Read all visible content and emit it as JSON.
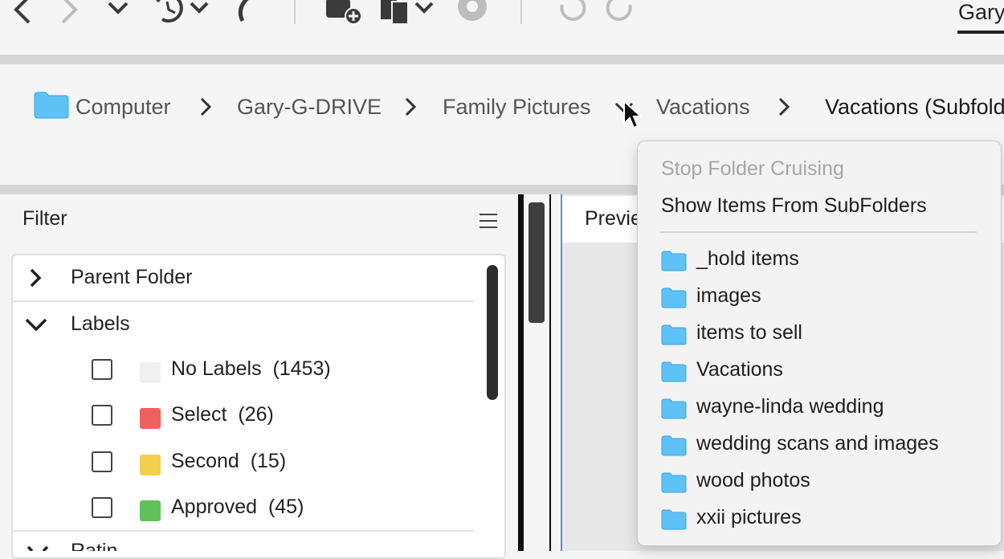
{
  "toolbar": {
    "icons": [
      "back-arrow-icon",
      "forward-arrow-icon",
      "chevron-down-icon",
      "recent-history-icon",
      "boomerang-icon",
      "get-photos-icon",
      "copy-to-icon",
      "camera-raw-icon",
      "rotate-left-icon",
      "rotate-right-icon"
    ],
    "workspace_tab": "Gary"
  },
  "breadcrumb": {
    "items": [
      "Computer",
      "Gary-G-DRIVE",
      "Family Pictures",
      "Vacations",
      "Vacations (Subfold"
    ],
    "folder_color": "#5ec2f7"
  },
  "filter": {
    "title": "Filter",
    "sections": {
      "parent_folder": "Parent Folder",
      "labels": "Labels",
      "ratings": "Ratin"
    },
    "labels": [
      {
        "name": "No Labels",
        "count": "(1453)",
        "color": "#f0f0f0"
      },
      {
        "name": "Select",
        "count": "(26)",
        "color": "#f06060"
      },
      {
        "name": "Second",
        "count": "(15)",
        "color": "#f2d04e"
      },
      {
        "name": "Approved",
        "count": "(45)",
        "color": "#5fc25a"
      }
    ]
  },
  "preview": {
    "tab_label": "Previe"
  },
  "folder_menu": {
    "stop_cruising": "Stop Folder Cruising",
    "show_subfolders": "Show Items From SubFolders",
    "folders": [
      "_hold items",
      "images",
      "items to sell",
      "Vacations",
      "wayne-linda wedding",
      "wedding scans and images",
      "wood photos",
      "xxii pictures"
    ]
  }
}
